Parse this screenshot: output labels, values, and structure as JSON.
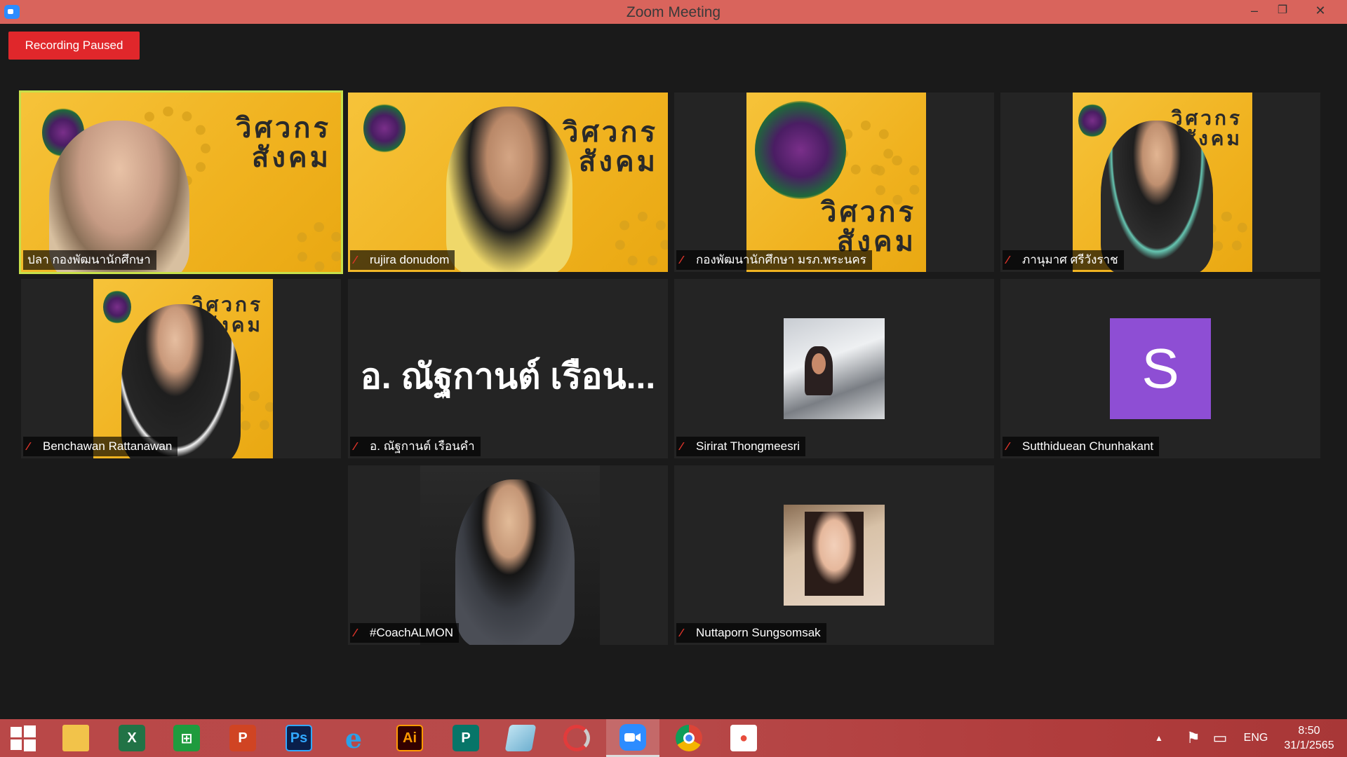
{
  "window": {
    "title": "Zoom Meeting",
    "minimize": "–",
    "restore": "❐",
    "close": "✕"
  },
  "recording": {
    "label": "Recording Paused"
  },
  "poster": {
    "title_line1": "วิศวกร",
    "title_line2": "สังคม"
  },
  "participants": [
    {
      "name": "ปลา กองพัฒนานักศึกษา",
      "muted": false,
      "active": true
    },
    {
      "name": "rujira donudom",
      "muted": true
    },
    {
      "name": "กองพัฒนานักศึกษา มรภ.พระนคร",
      "muted": true
    },
    {
      "name": "ภานุมาศ ศรีวังราช",
      "muted": true
    },
    {
      "name": "Benchawan Rattanawan",
      "muted": true
    },
    {
      "name": "อ. ณัฐกานต์ เรือนคำ",
      "display_name": "อ. ณัฐกานต์ เรือน...",
      "muted": true
    },
    {
      "name": "Sirirat Thongmeesri",
      "muted": true
    },
    {
      "name": "Sutthiduean Chunhakant",
      "letter": "S",
      "muted": true
    },
    {
      "name": "#CoachALMON",
      "muted": true
    },
    {
      "name": "Nuttaporn Sungsomsak",
      "muted": true
    }
  ],
  "taskbar": {
    "apps": [
      {
        "name": "Start",
        "icon": "windows-logo-icon"
      },
      {
        "name": "File Explorer",
        "icon": "folder-icon"
      },
      {
        "name": "Excel",
        "icon": "excel-icon",
        "glyph": "X"
      },
      {
        "name": "Store",
        "icon": "store-icon",
        "glyph": "⊞"
      },
      {
        "name": "PowerPoint",
        "icon": "powerpoint-icon",
        "glyph": "P"
      },
      {
        "name": "Photoshop",
        "icon": "photoshop-icon",
        "glyph": "Ps"
      },
      {
        "name": "Internet Explorer",
        "icon": "ie-icon",
        "glyph": "e"
      },
      {
        "name": "Illustrator",
        "icon": "illustrator-icon",
        "glyph": "Ai"
      },
      {
        "name": "Publisher",
        "icon": "publisher-icon",
        "glyph": "P"
      },
      {
        "name": "Notepad",
        "icon": "notepad-icon"
      },
      {
        "name": "Photoscape",
        "icon": "photoscape-icon"
      },
      {
        "name": "Zoom",
        "icon": "zoom-icon"
      },
      {
        "name": "Chrome",
        "icon": "chrome-icon"
      },
      {
        "name": "Office",
        "icon": "office-icon"
      }
    ],
    "language": "ENG",
    "time": "8:50",
    "date": "31/1/2565",
    "tray_up": "▲",
    "flag": "⚑",
    "network": "▭"
  },
  "colors": {
    "titlebar": "#d9645c",
    "recording": "#e0272b",
    "taskbar": "#b94848",
    "active_speaker": "#c7e04a",
    "letter_avatar": "#8e4ed4"
  }
}
